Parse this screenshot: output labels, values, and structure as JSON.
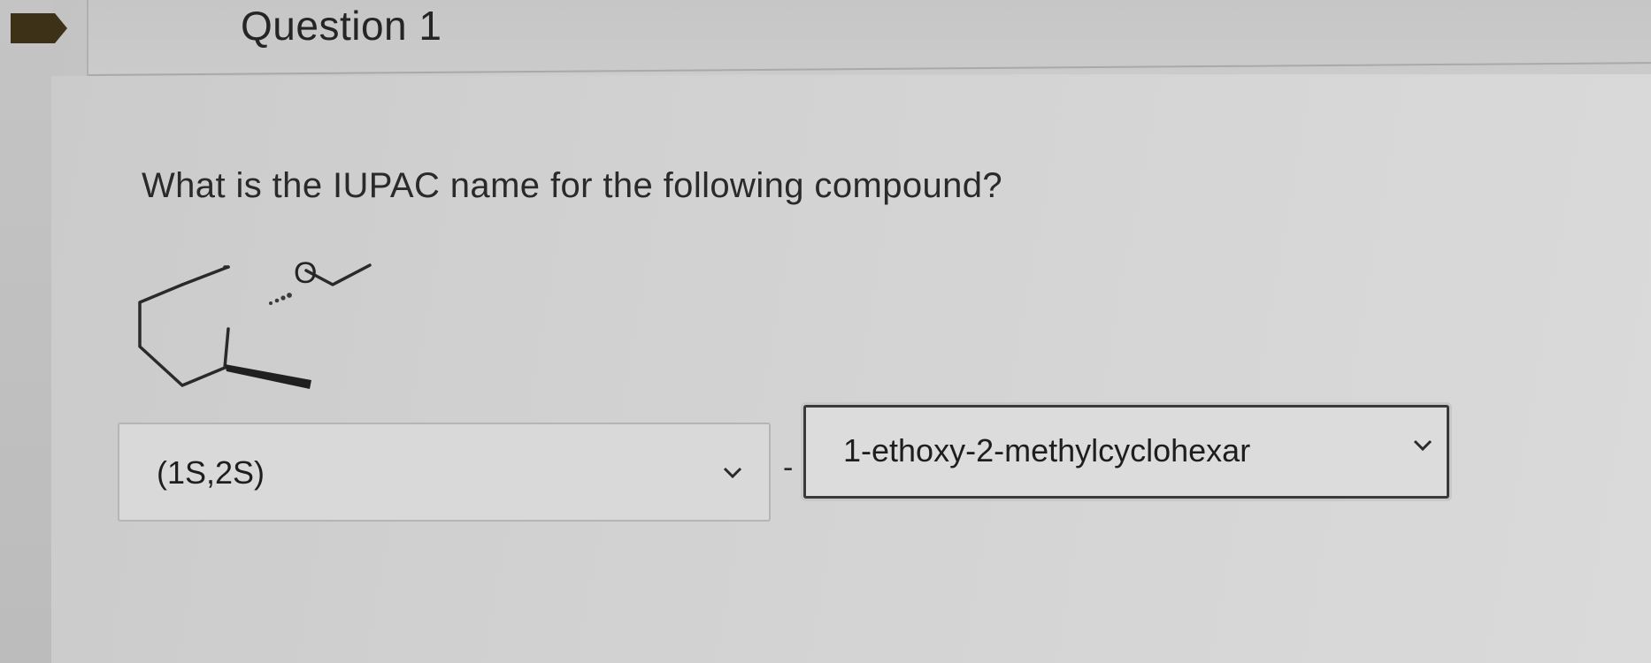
{
  "header": {
    "title": "Question 1"
  },
  "question": {
    "prompt": "What is the IUPAC name for the following compound?",
    "structure_label": "O"
  },
  "answer": {
    "stereo_select": {
      "value": "(1S,2S)"
    },
    "separator": "-",
    "name_select": {
      "value": "1-ethoxy-2-methylcyclohexar"
    }
  },
  "icons": {
    "flag": "bookmark-flag-icon",
    "chevron": "chevron-down-icon"
  },
  "colors": {
    "flag": "#3d3218",
    "text": "#252525"
  }
}
